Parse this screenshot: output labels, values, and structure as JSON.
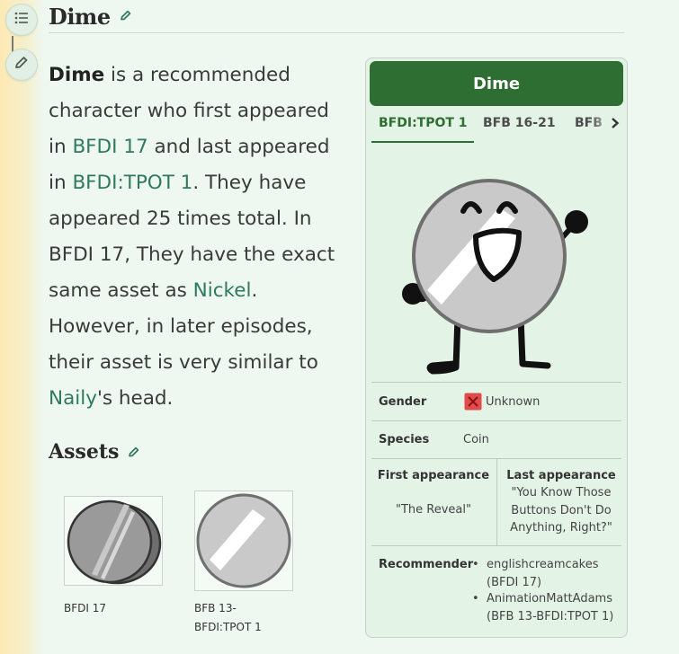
{
  "page": {
    "title": "Dime"
  },
  "article": {
    "name": "Dime",
    "s1": " is a recommended character who first appeared in ",
    "link_first": "BFDI 17",
    "s2": " and last appeared in ",
    "link_last": "BFDI:TPOT 1",
    "s3": ". They have appeared 25 times total. In BFDI 17, They have the exact same asset as ",
    "link_nickel": "Nickel",
    "s4": ". However, in later episodes, their asset is very similar to ",
    "link_naily": "Naily",
    "s5": "'s head."
  },
  "assets": {
    "title": "Assets",
    "items": [
      {
        "caption": "BFDI 17"
      },
      {
        "caption": "BFB 13-BFDI:TPOT 1"
      }
    ]
  },
  "infobox": {
    "title": "Dime",
    "tabs": [
      "BFDI:TPOT 1",
      "BFB 16-21",
      "BFB"
    ],
    "active_tab": 0,
    "gender_label": "Gender",
    "gender_value": "Unknown",
    "species_label": "Species",
    "species_value": "Coin",
    "first_label": "First appearance",
    "first_value": "\"The Reveal\"",
    "last_label": "Last appearance",
    "last_value": "\"You Know Those Buttons Don't Do Anything, Right?\"",
    "recommender_label": "Recommender",
    "recommenders": [
      {
        "name": "englishcreamcakes",
        "note": "(BFDI 17)"
      },
      {
        "name": "AnimationMattAdams",
        "note": "(BFB 13-BFDI:TPOT 1)"
      }
    ]
  },
  "icons": {
    "toc": "list-icon",
    "edit": "pencil-icon",
    "gender": "x-mark-icon",
    "tab_next": "chevron-right-icon"
  },
  "colors": {
    "header_green": "#2e6e32",
    "link": "#2e7a5a",
    "infobox_bg": "#e3f3e6",
    "unknown_red": "#e24b4b"
  }
}
